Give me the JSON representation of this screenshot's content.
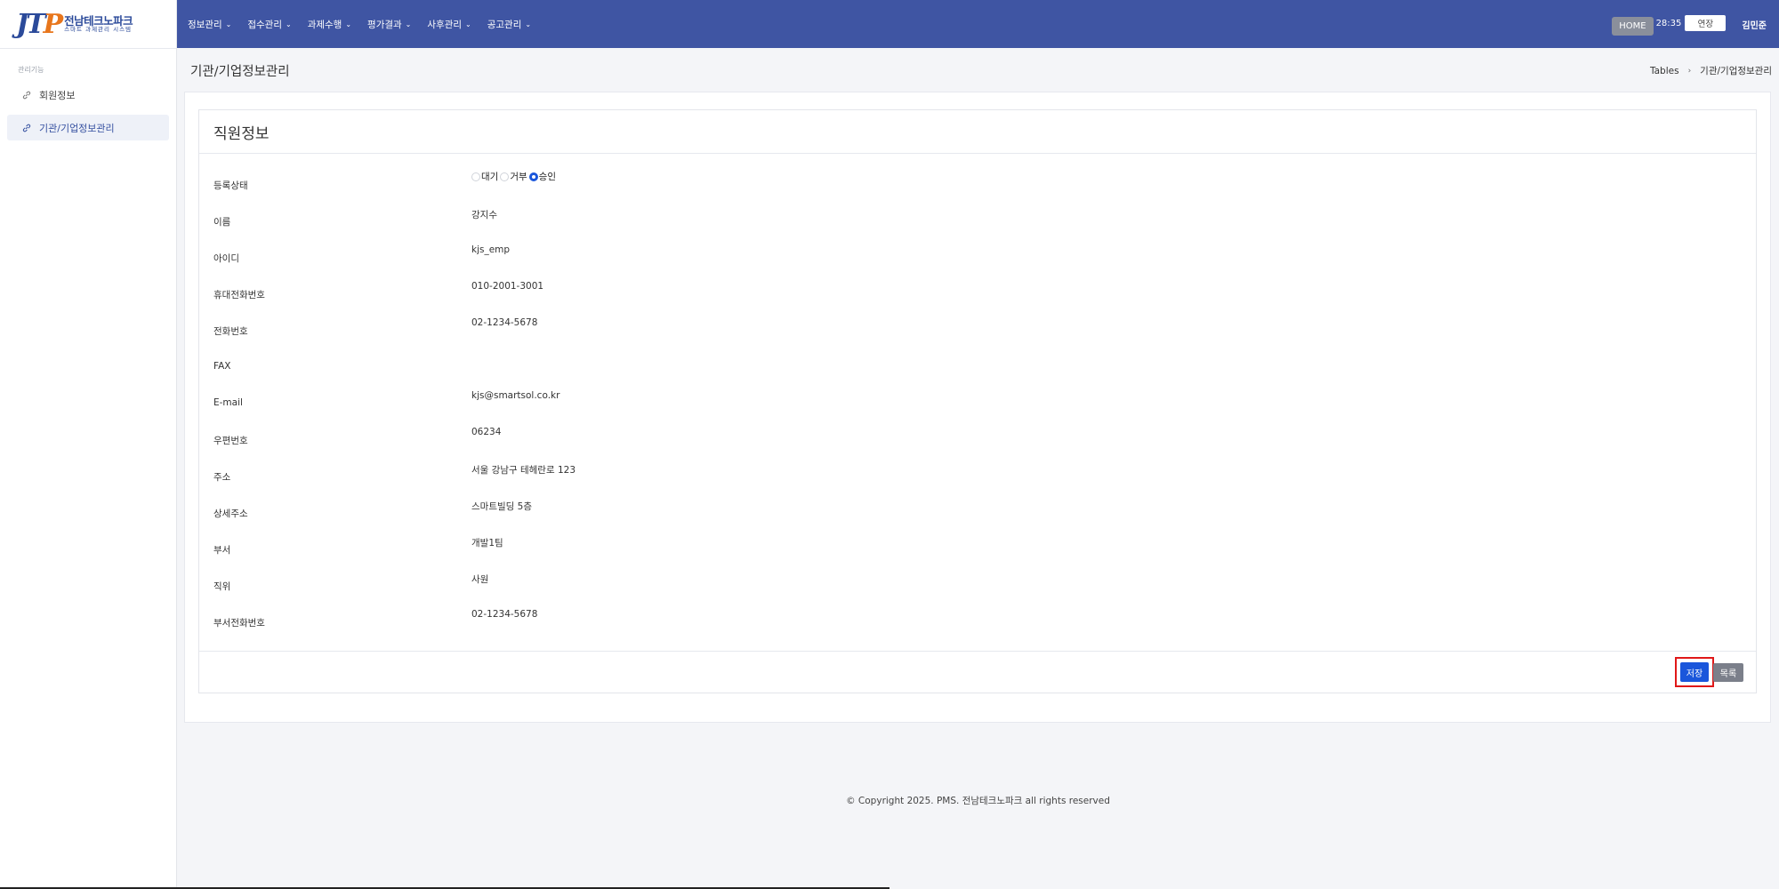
{
  "brand": {
    "mark": "JT",
    "mark_accent": "P",
    "title": "전남테크노파크",
    "subtitle": "스마트 과제관리 시스템"
  },
  "topnav": {
    "menus": [
      "정보관리",
      "접수관리",
      "과제수행",
      "평가결과",
      "사후관리",
      "공고관리"
    ],
    "home_label": "HOME",
    "timer": "28:35",
    "extend_label": "연장",
    "username": "김민준",
    "bg_color": "#3f55a3"
  },
  "sidebar": {
    "section_label": "관리기능",
    "items": [
      {
        "label": "회원정보",
        "icon": "link-icon",
        "active": false
      },
      {
        "label": "기관/기업정보관리",
        "icon": "link-icon",
        "active": true
      }
    ]
  },
  "page": {
    "title": "기관/기업정보관리",
    "breadcrumb": [
      "Tables",
      "기관/기업정보관리"
    ]
  },
  "card": {
    "title": "직원정보",
    "status": {
      "label": "등록상태",
      "options": [
        "대기",
        "거부",
        "승인"
      ],
      "selected": "승인"
    },
    "fields": [
      {
        "label": "이름",
        "value": "강지수"
      },
      {
        "label": "아이디",
        "value": "kjs_emp"
      },
      {
        "label": "휴대전화번호",
        "value": "010-2001-3001"
      },
      {
        "label": "전화번호",
        "value": "02-1234-5678"
      },
      {
        "label": "FAX",
        "value": ""
      },
      {
        "label": "E-mail",
        "value": "kjs@smartsol.co.kr"
      },
      {
        "label": "우편번호",
        "value": "06234"
      },
      {
        "label": "주소",
        "value": "서울 강남구 테헤란로 123"
      },
      {
        "label": "상세주소",
        "value": "스마트빌딩 5층"
      },
      {
        "label": "부서",
        "value": "개발1팀"
      },
      {
        "label": "직위",
        "value": "사원"
      },
      {
        "label": "부서전화번호",
        "value": "02-1234-5678"
      }
    ],
    "save_label": "저장",
    "list_label": "목록"
  },
  "footer": {
    "copyright": "© Copyright 2025. PMS. 전남테크노파크 all rights reserved"
  }
}
